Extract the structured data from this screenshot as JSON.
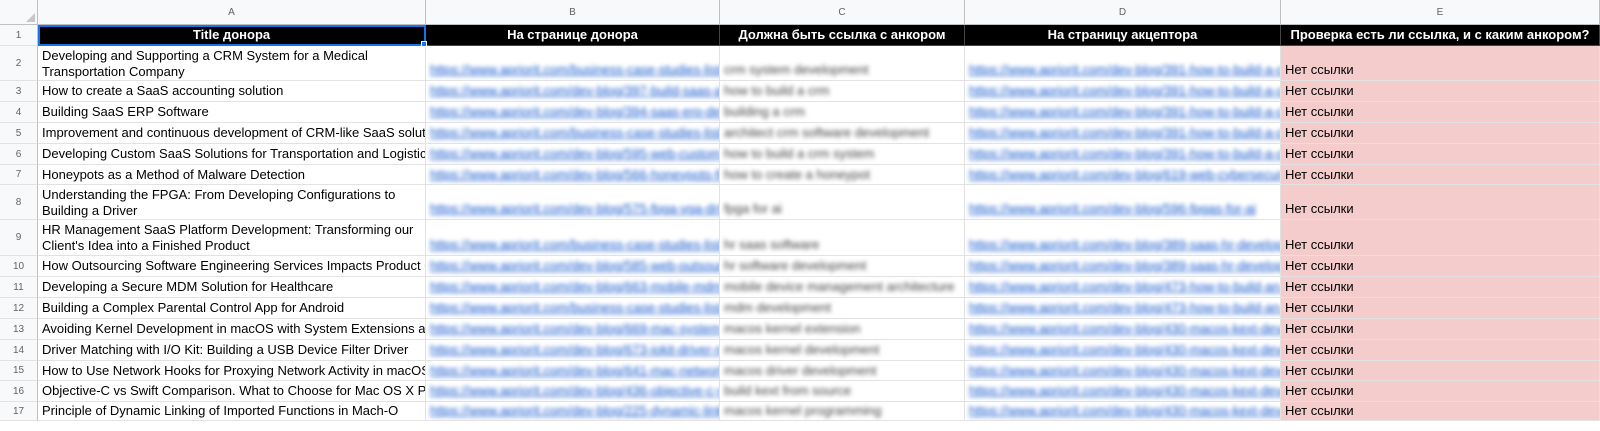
{
  "columns": [
    "A",
    "B",
    "C",
    "D",
    "E"
  ],
  "header": {
    "A": "Title донора",
    "B": "На странице донора",
    "C": "Должна быть ссылка с анкором",
    "D": "На страницу акцептора",
    "E": "Проверка есть ли ссылка, и с каким анкором?"
  },
  "rows": [
    {
      "num": "1"
    },
    {
      "num": "2",
      "title": "Developing and Supporting a CRM System for a Medical Transportation Company",
      "donor_url": "https://www.apriorit.com/business-case-studies-list/",
      "anchor": "crm system development",
      "acceptor_url": "https://www.apriorit.com/dev-blog/391-how-to-build-a-crm",
      "check": "Нет ссылки"
    },
    {
      "num": "3",
      "title": "How to create a SaaS accounting solution",
      "donor_url": "https://www.apriorit.com/dev-blog/397-build-saas-accounting",
      "anchor": "how to build a crm",
      "acceptor_url": "https://www.apriorit.com/dev-blog/391-how-to-build-a-crm",
      "check": "Нет ссылки"
    },
    {
      "num": "4",
      "title": "Building SaaS ERP Software",
      "donor_url": "https://www.apriorit.com/dev-blog/394-saas-erp-development",
      "anchor": "building a crm",
      "acceptor_url": "https://www.apriorit.com/dev-blog/391-how-to-build-a-crm",
      "check": "Нет ссылки"
    },
    {
      "num": "5",
      "title": "Improvement and continuous development of CRM-like SaaS solution",
      "donor_url": "https://www.apriorit.com/business-case-studies-list/",
      "anchor": "architect crm software development",
      "acceptor_url": "https://www.apriorit.com/dev-blog/391-how-to-build-a-crm",
      "check": "Нет ссылки"
    },
    {
      "num": "6",
      "title": "Developing Custom SaaS Solutions for Transportation and Logistics",
      "donor_url": "https://www.apriorit.com/dev-blog/595-web-custom-saas",
      "anchor": "how to build a crm system",
      "acceptor_url": "https://www.apriorit.com/dev-blog/391-how-to-build-a-crm",
      "check": "Нет ссылки"
    },
    {
      "num": "7",
      "title": "Honeypots as a Method of Malware Detection",
      "donor_url": "https://www.apriorit.com/dev-blog/566-honeypots-for-malware",
      "anchor": "how to create a honeypot",
      "acceptor_url": "https://www.apriorit.com/dev-blog/619-web-cybersecurity",
      "check": "Нет ссылки"
    },
    {
      "num": "8",
      "title": "Understanding the FPGA: From Developing Configurations to Building a Driver",
      "donor_url": "https://www.apriorit.com/dev-blog/575-fpga-vga-driver",
      "anchor": "fpga for ai",
      "acceptor_url": "https://www.apriorit.com/dev-blog/596-fpgas-for-ai",
      "check": "Нет ссылки"
    },
    {
      "num": "9",
      "title": "HR Management SaaS Platform Development: Transforming our Client's Idea into a Finished Product",
      "donor_url": "https://www.apriorit.com/business-case-studies-list/",
      "anchor": "hr saas software",
      "acceptor_url": "https://www.apriorit.com/dev-blog/389-saas-hr-development",
      "check": "Нет ссылки"
    },
    {
      "num": "10",
      "title": "How Outsourcing Software Engineering Services Impacts Product Quality",
      "donor_url": "https://www.apriorit.com/dev-blog/585-web-outsourcing",
      "anchor": "hr software development",
      "acceptor_url": "https://www.apriorit.com/dev-blog/389-saas-hr-development",
      "check": "Нет ссылки"
    },
    {
      "num": "11",
      "title": "Developing a Secure MDM Solution for Healthcare",
      "donor_url": "https://www.apriorit.com/dev-blog/663-mobile-mdm-healthcare",
      "anchor": "mobile device management architecture",
      "acceptor_url": "https://www.apriorit.com/dev-blog/473-how-to-build-an-mdm",
      "check": "Нет ссылки"
    },
    {
      "num": "12",
      "title": "Building a Complex Parental Control App for Android",
      "donor_url": "https://www.apriorit.com/business-case-studies-list/",
      "anchor": "mdm development",
      "acceptor_url": "https://www.apriorit.com/dev-blog/473-how-to-build-an-mdm",
      "check": "Нет ссылки"
    },
    {
      "num": "13",
      "title": "Avoiding Kernel Development in macOS with System Extensions and DriverKit",
      "donor_url": "https://www.apriorit.com/dev-blog/669-mac-system-extensions",
      "anchor": "macos kernel extension",
      "acceptor_url": "https://www.apriorit.com/dev-blog/430-macos-kext-development",
      "check": "Нет ссылки"
    },
    {
      "num": "14",
      "title": "Driver Matching with I/O Kit: Building a USB Device Filter Driver",
      "donor_url": "https://www.apriorit.com/dev-blog/673-iokit-driver-matching",
      "anchor": "macos kernel development",
      "acceptor_url": "https://www.apriorit.com/dev-blog/430-macos-kext-development",
      "check": "Нет ссылки"
    },
    {
      "num": "15",
      "title": "How to Use Network Hooks for Proxying Network Activity in macOS",
      "donor_url": "https://www.apriorit.com/dev-blog/641-mac-network-hooks",
      "anchor": "macos driver development",
      "acceptor_url": "https://www.apriorit.com/dev-blog/430-macos-kext-development",
      "check": "Нет ссылки"
    },
    {
      "num": "16",
      "title": "Objective-C vs Swift Comparison. What to Choose for Mac OS X Programming",
      "donor_url": "https://www.apriorit.com/dev-blog/436-objective-c-vs-swift",
      "anchor": "build kext from source",
      "acceptor_url": "https://www.apriorit.com/dev-blog/430-macos-kext-development",
      "check": "Нет ссылки"
    },
    {
      "num": "17",
      "title": "Principle of Dynamic Linking of Imported Functions in Mach-O",
      "donor_url": "https://www.apriorit.com/dev-blog/225-dynamic-linking-mach-o",
      "anchor": "macos kernel programming",
      "acceptor_url": "https://www.apriorit.com/dev-blog/430-macos-kext-development",
      "check": "Нет ссылки"
    }
  ]
}
